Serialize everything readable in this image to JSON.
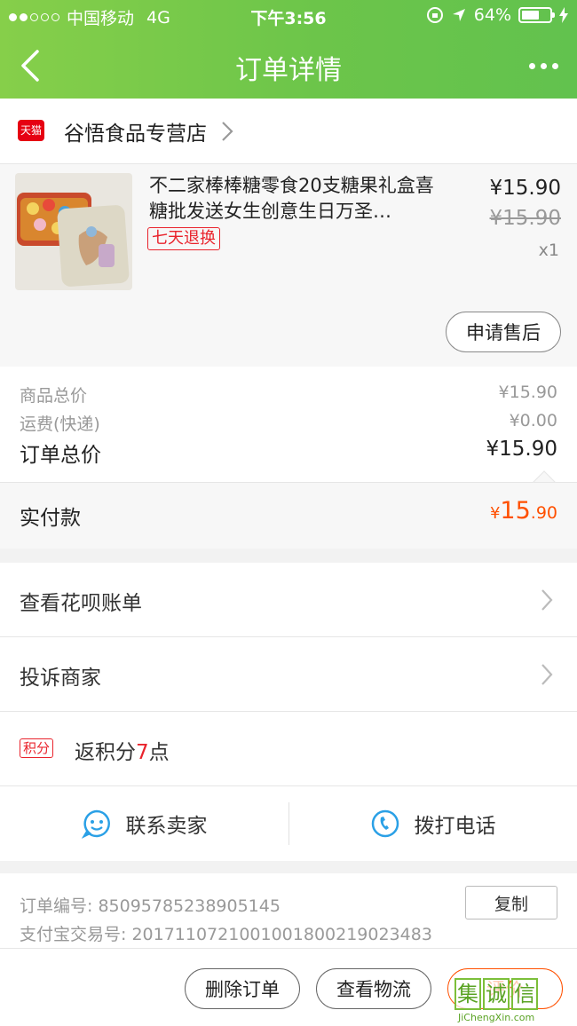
{
  "status_bar": {
    "carrier": "中国移动",
    "network": "4G",
    "time": "下午3:56",
    "battery": "64%",
    "battery_level": 0.64
  },
  "nav": {
    "title": "订单详情"
  },
  "store": {
    "badge": "天猫",
    "name": "谷悟食品专营店"
  },
  "product": {
    "title": "不二家棒棒糖零食20支糖果礼盒喜糖批发送女生创意生日万圣…",
    "tag": "七天退换",
    "price": "¥15.90",
    "original_price": "¥15.90",
    "quantity": "x1",
    "after_sale_label": "申请售后"
  },
  "summary": {
    "goods_total_label": "商品总价",
    "goods_total_value": "¥15.90",
    "shipping_label": "运费(快递)",
    "shipping_value": "¥0.00",
    "order_total_label": "订单总价",
    "order_total_value": "¥15.90"
  },
  "paid": {
    "label": "实付款",
    "currency": "¥",
    "integer": "15",
    "decimal": ".90"
  },
  "list": {
    "huabei_label": "查看花呗账单",
    "complaint_label": "投诉商家",
    "points_badge": "积分",
    "points_prefix": "返积分",
    "points_number": "7",
    "points_suffix": "点"
  },
  "contact": {
    "seller_label": "联系卖家",
    "phone_label": "拨打电话"
  },
  "info": {
    "order_no": "订单编号:  85095785238905145",
    "alipay_no": "支付宝交易号:  2017110721001001800219023483",
    "copy_label": "复制"
  },
  "bottom_actions": {
    "delete_label": "删除订单",
    "logistics_label": "查看物流",
    "review_label": "评价"
  },
  "watermark": {
    "chars": [
      "集",
      "诚",
      "信"
    ],
    "url": "JiChengXin.com"
  },
  "colors": {
    "nav_green": "#6cc54a",
    "accent_orange": "#ff5000",
    "tmall_red": "#e60012",
    "tag_red": "#e9232c",
    "icon_blue": "#2aa0e6"
  }
}
